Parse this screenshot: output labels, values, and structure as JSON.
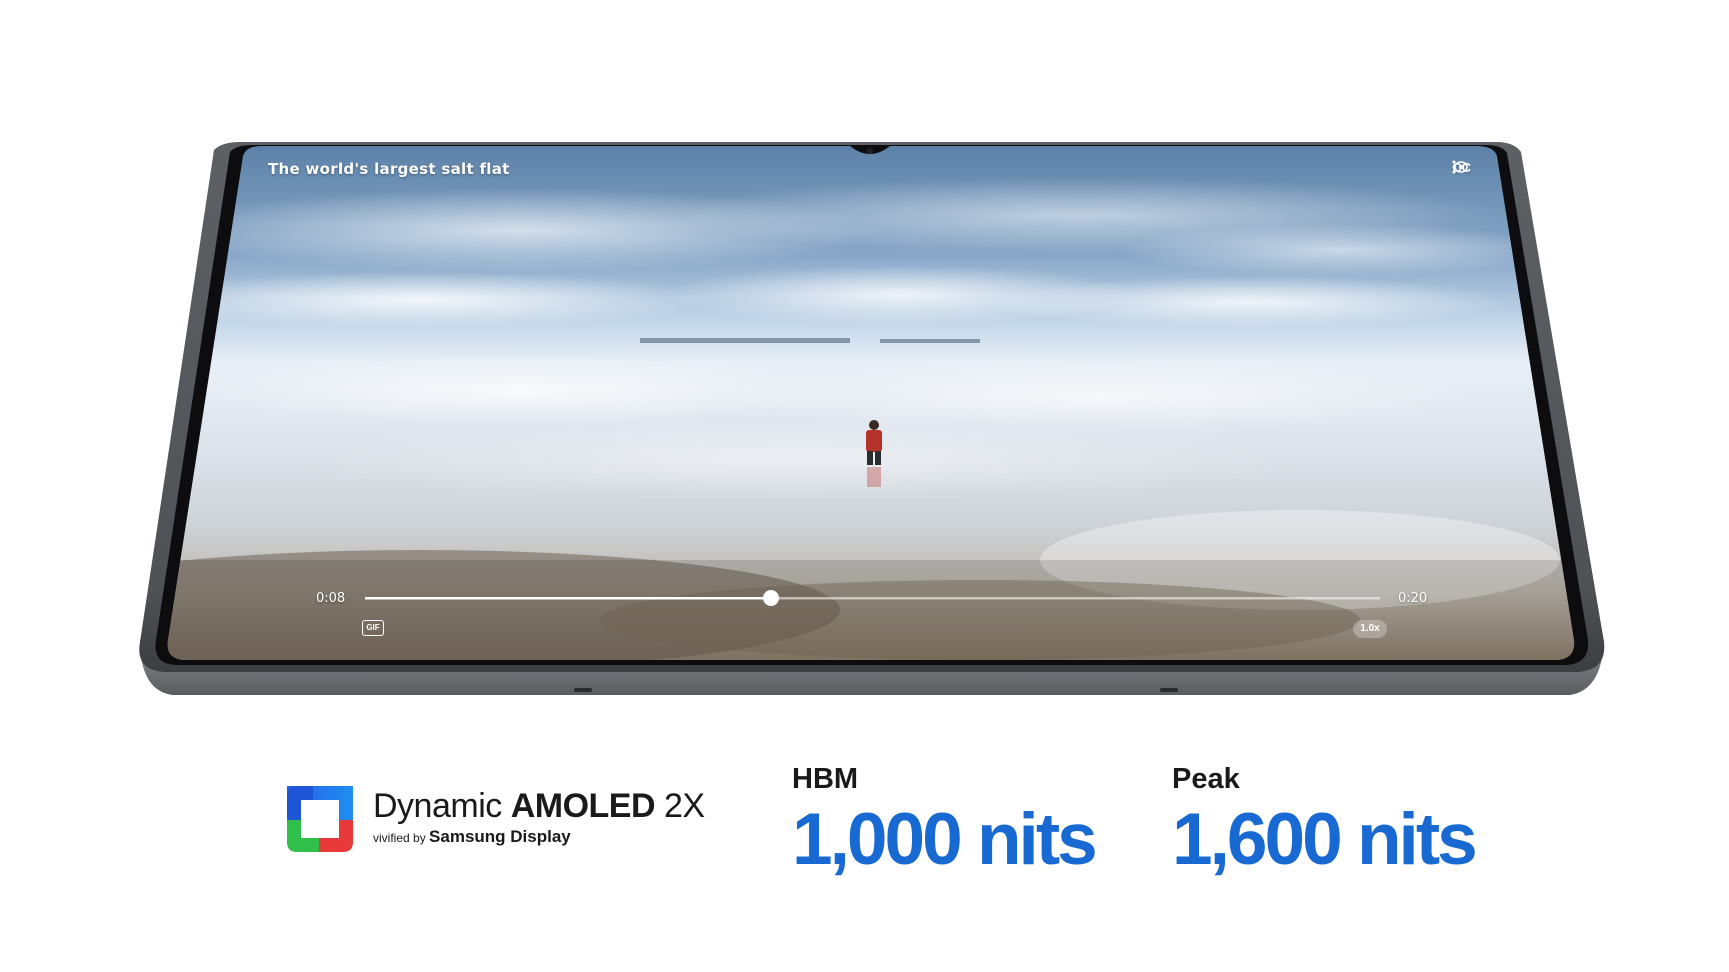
{
  "video": {
    "title": "The world's largest salt flat",
    "cc_label": "CC",
    "current_time": "0:08",
    "duration": "0:20",
    "progress": 0.4,
    "speed_label": "1.0x",
    "gif_label": "GIF"
  },
  "brand": {
    "name_light": "Dynamic ",
    "name_bold": "AMOLED",
    "name_suffix": " 2X",
    "sub_small": "vivified by ",
    "sub_bold": "Samsung Display"
  },
  "stats": [
    {
      "label": "HBM",
      "value": "1,000 nits"
    },
    {
      "label": "Peak",
      "value": "1,600 nits"
    }
  ],
  "colors": {
    "accent": "#1969d3"
  }
}
